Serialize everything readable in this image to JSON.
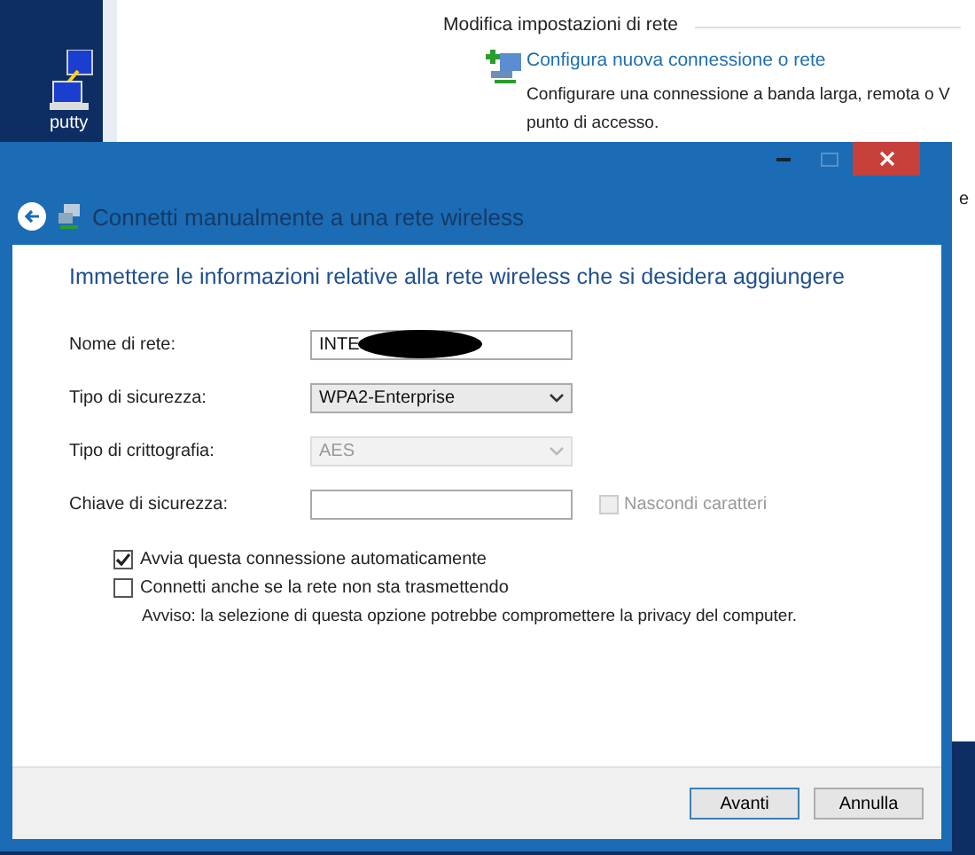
{
  "desktop": {
    "icon_label": "putty"
  },
  "background_window": {
    "section_title": "Modifica impostazioni di rete",
    "link": "Configura nuova connessione o rete",
    "description": "Configurare una connessione a banda larga, remota o V",
    "description_2": "punto di accesso.",
    "edge_text": "e"
  },
  "dialog": {
    "title": "Connetti manualmente a una rete wireless",
    "heading": "Immettere le informazioni relative alla rete wireless che si desidera aggiungere",
    "fields": [
      {
        "kind": "text",
        "label": "Nome di rete:",
        "value": "INTE",
        "redacted": true,
        "disabled": false
      },
      {
        "kind": "select",
        "label": "Tipo di sicurezza:",
        "value": "WPA2-Enterprise",
        "disabled": false
      },
      {
        "kind": "select",
        "label": "Tipo di crittografia:",
        "value": "AES",
        "disabled": true
      },
      {
        "kind": "text",
        "label": "Chiave di sicurezza:",
        "disabled": false,
        "side_checkbox": {
          "label": "Nascondi caratteri",
          "checked": false,
          "disabled": true
        }
      }
    ],
    "options": [
      {
        "label": "Avvia questa connessione automaticamente",
        "checked": true
      },
      {
        "label": "Connetti anche se la rete non sta trasmettendo",
        "checked": false,
        "note": "Avviso: la selezione di questa opzione potrebbe compromettere la privacy del computer."
      }
    ],
    "buttons": [
      {
        "label": "Avanti",
        "default": true
      },
      {
        "label": "Annulla",
        "default": false
      }
    ]
  }
}
